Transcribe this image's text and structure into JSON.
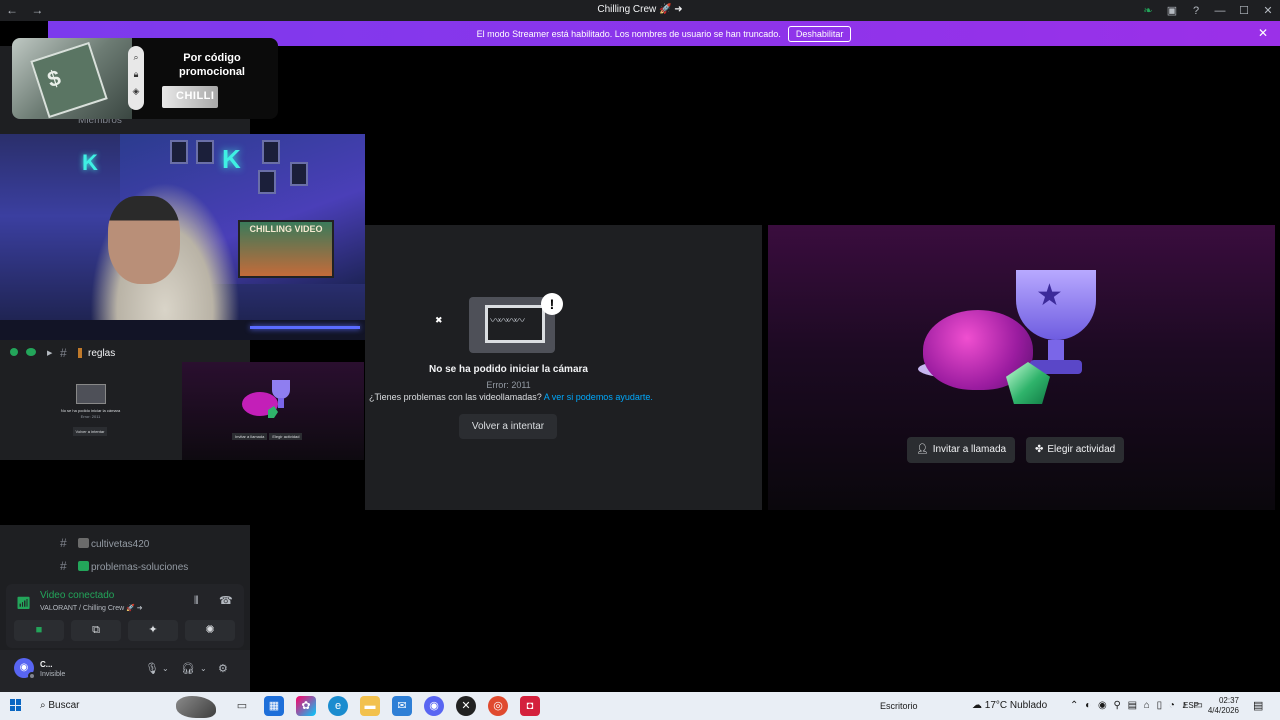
{
  "window": {
    "title": "Chilling Crew",
    "title_suffix": "🚀 ➜",
    "nav_back": "←",
    "nav_forward": "→",
    "controls": [
      "—",
      "☐",
      "✕"
    ]
  },
  "streamer_bar": {
    "message": "El modo Streamer está habilitado. Los nombres de usuario se han truncado.",
    "button": "Deshabilitar"
  },
  "promo": {
    "text": "Por código promocional",
    "code": "CHILLI"
  },
  "sidebar": {
    "members_label": "Miembros",
    "channels": [
      {
        "name": "reglas"
      },
      {
        "name": "cultivetas420"
      },
      {
        "name": "problemas-soluciones"
      }
    ]
  },
  "webcam": {
    "poster_text": "CHILLING VIDEO"
  },
  "voice": {
    "status": "Video conectado",
    "server": "VALORANT / Chilling Crew 🚀 ➜"
  },
  "user": {
    "name": "C...",
    "status": "Invisible"
  },
  "camera_error": {
    "title": "No se ha podido iniciar la cámara",
    "code": "Error: 2011",
    "help_text": "¿Tienes problemas con las videollamadas?",
    "help_link": "A ver si podemos ayudarte.",
    "retry_button": "Volver a intentar"
  },
  "activity": {
    "invite_button": "Invitar a llamada",
    "choose_button": "Elegir actividad"
  },
  "mini_thumbs": {
    "error_title": "No se ha podido iniciar la cámara",
    "error_code": "Error: 2011",
    "retry": "Volver a intentar",
    "invite": "Invitar a llamada",
    "choose": "Elegir actividad"
  },
  "taskbar": {
    "search": "Buscar",
    "desktop": "Escritorio",
    "weather": "17°C  Nublado",
    "language": "ESP",
    "time": "02:37",
    "date": "4/4/2026"
  },
  "colors": {
    "streamer_purple": "#8b3ae8",
    "online_green": "#23a55a",
    "link_blue": "#00a8fc",
    "background": "#1e1f22"
  }
}
